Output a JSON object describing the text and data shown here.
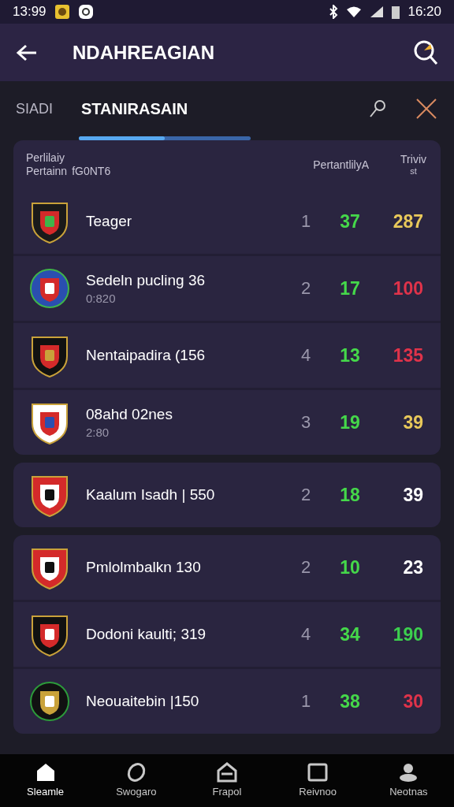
{
  "status_bar": {
    "time_left": "13:99",
    "time_right": "16:20"
  },
  "header": {
    "title": "NDAHREAGIAN"
  },
  "tabs": [
    {
      "label": "SIADI",
      "selected": false
    },
    {
      "label": "STANIRASAIN",
      "selected": true
    }
  ],
  "tab_indicator": {
    "level": 0.5
  },
  "table": {
    "columns": [
      {
        "line1": "Perlilaiy",
        "line2": "Pertainn"
      },
      {
        "line1": "fG0NT6"
      },
      {
        "line1": "PertantlilyA"
      },
      {
        "line1": "Triviv",
        "line2": "st"
      }
    ],
    "groups": [
      {
        "rows": [
          {
            "name": "Teager",
            "rank": "1",
            "points": "37",
            "value": "287",
            "color": "#e8c85a"
          },
          {
            "name": "Sedeln pucling 36",
            "sub": "0:820",
            "rank": "2",
            "points": "17",
            "value": "100",
            "color": "#e0334a"
          },
          {
            "name": "Nentaipadira (156",
            "rank": "4",
            "points": "13",
            "value": "135",
            "color": "#e0334a"
          },
          {
            "name": "08ahd 02nes",
            "sub": "2:80",
            "rank": "3",
            "points": "19",
            "value": "39",
            "color": "#e8c85a"
          }
        ]
      },
      {
        "rows": [
          {
            "name": "Kaalum Isadh | 550",
            "rank": "2",
            "points": "18",
            "value": "39",
            "color": "#ffffff"
          }
        ]
      },
      {
        "rows": [
          {
            "name": "Pmlolmbalkn  130",
            "rank": "2",
            "points": "10",
            "value": "23",
            "color": "#ffffff"
          },
          {
            "name": "Dodoni kaulti; 319",
            "rank": "4",
            "points": "34",
            "value": "190",
            "color": "#3ccf4e"
          },
          {
            "name": "Neouaitebin |150",
            "rank": "1",
            "points": "38",
            "value": "30",
            "color": "#e0334a"
          }
        ]
      }
    ]
  },
  "nav": [
    {
      "label": "Sleamle",
      "selected": true
    },
    {
      "label": "Swogaro",
      "selected": false
    },
    {
      "label": "Frapol",
      "selected": false
    },
    {
      "label": "Reivnoo",
      "selected": false
    },
    {
      "label": "Neotnas",
      "selected": false
    }
  ]
}
